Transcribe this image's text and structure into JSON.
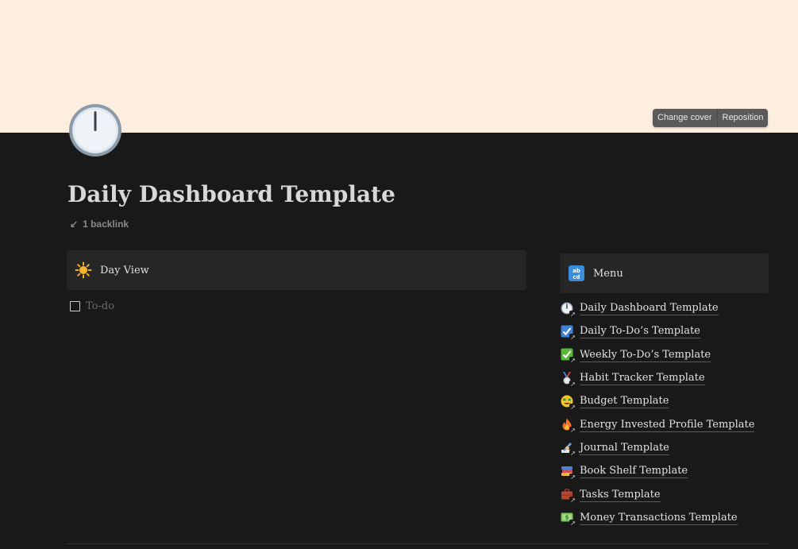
{
  "cover": {
    "color": "#fdeee0",
    "buttons": [
      "Change cover",
      "Reposition"
    ]
  },
  "page": {
    "icon": "clock-icon",
    "title": "Daily Dashboard Template",
    "backlinks": "1 backlink"
  },
  "day_view": {
    "icon": "sun-icon",
    "label": "Day View",
    "todo_placeholder": "To-do",
    "todo_checked": false
  },
  "menu": {
    "icon": "abcd-icon",
    "label": "Menu",
    "items": [
      {
        "label": "Daily Dashboard Template",
        "icon": "clock-icon"
      },
      {
        "label": "Daily To-Do’s Template",
        "icon": "check-box-icon"
      },
      {
        "label": "Weekly To-Do’s Template",
        "icon": "check-mark-button-icon"
      },
      {
        "label": "Habit Tracker Template",
        "icon": "medal-icon"
      },
      {
        "label": "Budget Template",
        "icon": "money-face-icon"
      },
      {
        "label": "Energy Invested Profile Template",
        "icon": "fire-icon"
      },
      {
        "label": "Journal Template",
        "icon": "writing-hand-icon"
      },
      {
        "label": "Book Shelf Template",
        "icon": "books-icon"
      },
      {
        "label": "Tasks Template",
        "icon": "briefcase-icon"
      },
      {
        "label": "Money Transactions Template",
        "icon": "dollar-bill-icon"
      }
    ]
  }
}
